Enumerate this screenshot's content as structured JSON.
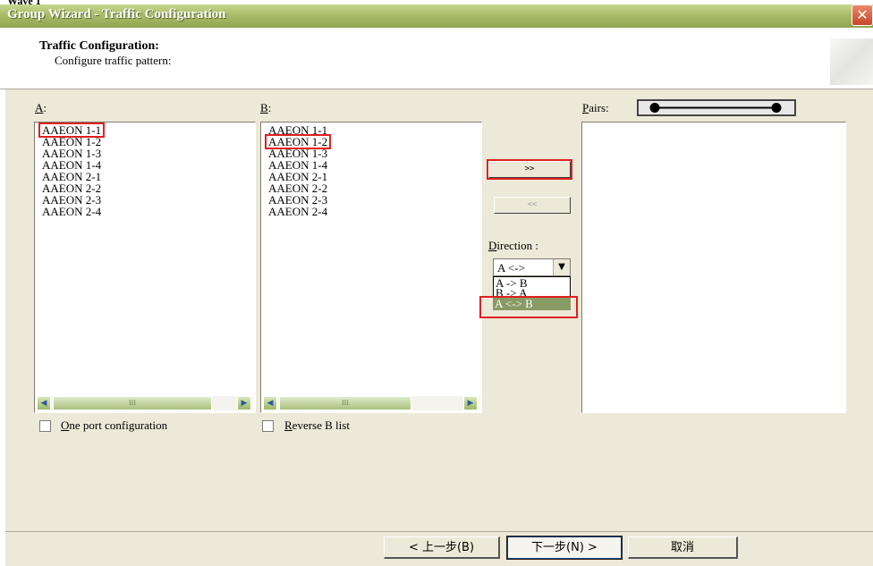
{
  "window": {
    "top_fragment": "Wave 1",
    "title": "Group Wizard - Traffic Configuration",
    "close_glyph": "✕"
  },
  "header": {
    "title": "Traffic Configuration:",
    "subtitle": "Configure traffic pattern:"
  },
  "list_a": {
    "label_key": "A",
    "label_rest": ":",
    "items": [
      "AAEON 1-1",
      "AAEON 1-2",
      "AAEON 1-3",
      "AAEON 1-4",
      "AAEON 2-1",
      "AAEON 2-2",
      "AAEON 2-3",
      "AAEON 2-4"
    ],
    "highlighted_index": 0,
    "checkbox": {
      "key": "O",
      "rest": "ne port configuration",
      "checked": false
    }
  },
  "list_b": {
    "label_key": "B",
    "label_rest": ":",
    "items": [
      "AAEON 1-1",
      "AAEON 1-2",
      "AAEON 1-3",
      "AAEON 1-4",
      "AAEON 2-1",
      "AAEON 2-2",
      "AAEON 2-3",
      "AAEON 2-4"
    ],
    "highlighted_index": 1,
    "checkbox": {
      "key": "R",
      "rest": "everse B list",
      "checked": false
    }
  },
  "buttons": {
    "add": ">>",
    "remove": "<<",
    "remove_enabled": false
  },
  "direction": {
    "label_key": "D",
    "label_rest": "irection :",
    "selected": "A <->",
    "options": [
      "A -> B",
      "B -> A",
      "A <-> B"
    ],
    "highlighted_option_index": 2
  },
  "pairs": {
    "label_key": "P",
    "label_rest": "airs:",
    "items": []
  },
  "scrollbar": {
    "left": "◀",
    "right": "▶",
    "thumb": "III"
  },
  "footer": {
    "back": "< 上一步(B)",
    "next": "下一步(N) >",
    "cancel": "取消"
  },
  "colors": {
    "title_bar": "#a9bc68",
    "highlight": "#e02020",
    "selection": "#8a9a64",
    "body": "#ece9d8"
  }
}
